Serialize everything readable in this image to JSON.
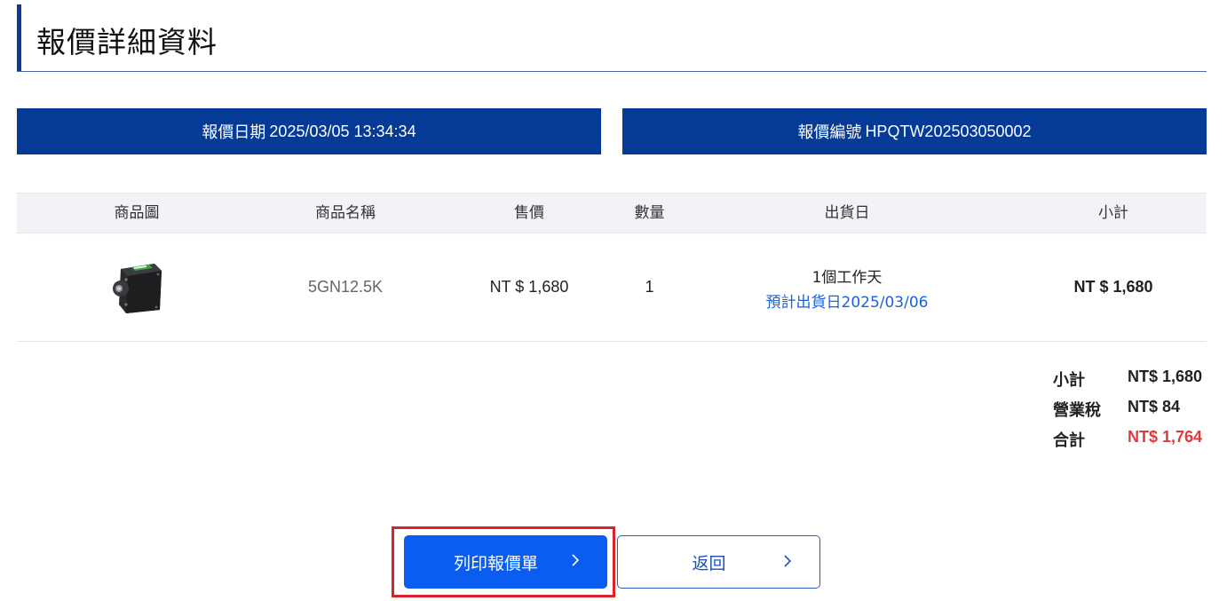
{
  "page": {
    "title": "報價詳細資料"
  },
  "info": {
    "date_label": "報價日期",
    "date_value": "2025/03/05 13:34:34",
    "number_label": "報價編號",
    "number_value": "HPQTW202503050002"
  },
  "table": {
    "headers": [
      "商品圖",
      "商品名稱",
      "售價",
      "數量",
      "出貨日",
      "小計"
    ],
    "rows": [
      {
        "image": "gear-motor-product-image",
        "name": "5GN12.5K",
        "price": "NT $ 1,680",
        "qty": "1",
        "ship_days": "1個工作天",
        "ship_estimate": "預計出貨日2025/03/06",
        "subtotal": "NT $ 1,680"
      }
    ]
  },
  "totals": {
    "subtotal_label": "小計",
    "subtotal_value": "NT$ 1,680",
    "tax_label": "營業稅",
    "tax_value": "NT$ 84",
    "total_label": "合計",
    "total_value": "NT$ 1,764"
  },
  "buttons": {
    "print_label": "列印報價單",
    "back_label": "返回",
    "chevron_icon": "chevron-right-icon"
  },
  "colors": {
    "header_bar": "#053a97",
    "primary_button": "#0b5cf0",
    "link_blue": "#1a62d8",
    "total_red": "#e03a3a",
    "highlight_border": "#d9232d"
  }
}
